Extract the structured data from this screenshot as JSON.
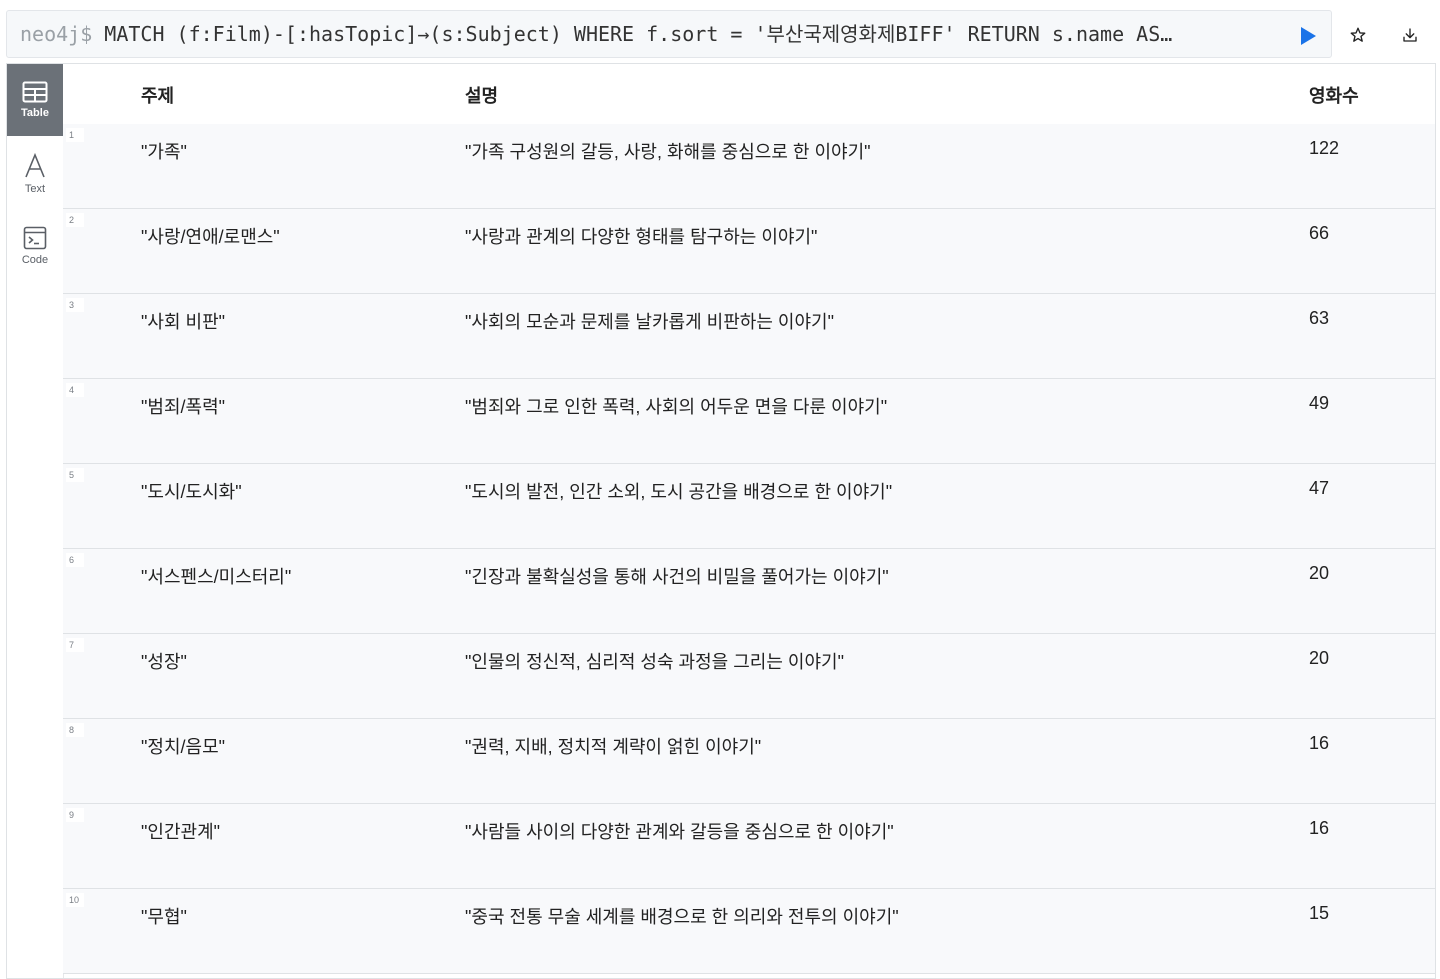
{
  "editor": {
    "prompt": "neo4j$",
    "query": "MATCH (f:Film)-[:hasTopic]→(s:Subject) WHERE f.sort = '부산국제영화제BIFF' RETURN s.name AS…"
  },
  "icons": {
    "run": "play-icon",
    "favorite": "star-icon",
    "download": "download-icon",
    "table_view": "table-icon",
    "text_view": "text-icon",
    "code_view": "code-icon"
  },
  "colors": {
    "run_accent": "#1a73e8",
    "active_view_bg": "#6b7178"
  },
  "views": [
    {
      "label": "Table",
      "active": true
    },
    {
      "label": "Text",
      "active": false
    },
    {
      "label": "Code",
      "active": false
    }
  ],
  "table": {
    "headers": [
      "주제",
      "설명",
      "영화수"
    ],
    "rows": [
      {
        "num": "1",
        "subject": "\"가족\"",
        "desc": "\"가족 구성원의 갈등, 사랑, 화해를 중심으로 한 이야기\"",
        "count": "122"
      },
      {
        "num": "2",
        "subject": "\"사랑/연애/로맨스\"",
        "desc": "\"사랑과 관계의 다양한 형태를 탐구하는 이야기\"",
        "count": "66"
      },
      {
        "num": "3",
        "subject": "\"사회 비판\"",
        "desc": "\"사회의 모순과 문제를 날카롭게 비판하는 이야기\"",
        "count": "63"
      },
      {
        "num": "4",
        "subject": "\"범죄/폭력\"",
        "desc": "\"범죄와 그로 인한 폭력, 사회의 어두운 면을 다룬 이야기\"",
        "count": "49"
      },
      {
        "num": "5",
        "subject": "\"도시/도시화\"",
        "desc": "\"도시의 발전, 인간 소외, 도시 공간을 배경으로 한 이야기\"",
        "count": "47"
      },
      {
        "num": "6",
        "subject": "\"서스펜스/미스터리\"",
        "desc": "\"긴장과 불확실성을 통해 사건의 비밀을 풀어가는 이야기\"",
        "count": "20"
      },
      {
        "num": "7",
        "subject": "\"성장\"",
        "desc": "\"인물의 정신적, 심리적 성숙 과정을 그리는 이야기\"",
        "count": "20"
      },
      {
        "num": "8",
        "subject": "\"정치/음모\"",
        "desc": "\"권력, 지배, 정치적 계략이 얽힌 이야기\"",
        "count": "16"
      },
      {
        "num": "9",
        "subject": "\"인간관계\"",
        "desc": "\"사람들 사이의 다양한 관계와 갈등을 중심으로 한 이야기\"",
        "count": "16"
      },
      {
        "num": "10",
        "subject": "\"무협\"",
        "desc": "\"중국 전통 무술 세계를 배경으로 한 의리와 전투의 이야기\"",
        "count": "15"
      }
    ]
  }
}
